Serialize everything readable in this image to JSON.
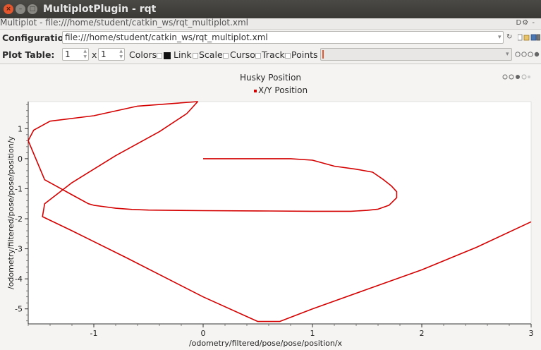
{
  "window": {
    "title": "MultiplotPlugin - rqt",
    "close_glyph": "×",
    "min_glyph": "–",
    "max_glyph": "□"
  },
  "dock": {
    "title": "Multiplot - file:///home/student/catkin_ws/rqt_multiplot.xml",
    "icons": "D⚙ -"
  },
  "config": {
    "label": "Configuration:",
    "value": "file:///home/student/catkin_ws/rqt_multiplot.xml"
  },
  "plot_table": {
    "label": "Plot Table:",
    "rows": "1",
    "x_label": "x",
    "cols": "1",
    "options": [
      {
        "label": "Colors",
        "checked": false
      },
      {
        "label": "Link",
        "checked": true
      },
      {
        "label": "Scale",
        "checked": false
      },
      {
        "label": "Cursor",
        "checked": false
      },
      {
        "label": "Track",
        "checked": false
      },
      {
        "label": "Points",
        "checked": false
      }
    ]
  },
  "plot": {
    "title": "Husky Position",
    "legend": "X/Y Position",
    "line_color": "#d40000"
  },
  "chart_data": {
    "type": "line",
    "title": "Husky Position",
    "xlabel": "/odometry/filtered/pose/pose/position/x",
    "ylabel": "/odometry/filtered/pose/pose/position/y",
    "xlim": [
      -1.6,
      3.0
    ],
    "ylim": [
      -5.5,
      1.9
    ],
    "xticks": [
      -1,
      0,
      1,
      2,
      3
    ],
    "yticks": [
      1,
      0,
      -1,
      -2,
      -3,
      -4,
      -5
    ],
    "grid": false,
    "legend_position": "top-center",
    "series": [
      {
        "name": "X/Y Position",
        "color": "#d40000",
        "x": [
          0.0,
          0.8,
          1.0,
          1.2,
          1.4,
          1.55,
          1.65,
          1.72,
          1.77,
          1.77,
          1.7,
          1.6,
          1.5,
          1.35,
          1.0,
          0.5,
          0.0,
          -0.3,
          -0.5,
          -0.65,
          -0.8,
          -0.9,
          -1.0,
          -1.05,
          -1.2,
          -1.35,
          -1.45,
          -1.6,
          -1.55,
          -1.4,
          -1.0,
          -0.6,
          -0.05,
          -0.15,
          -0.4,
          -0.8,
          -1.2,
          -1.45,
          -1.47,
          -1.2,
          -0.7,
          0.0,
          0.5,
          0.7,
          1.0,
          1.5,
          2.0,
          2.5,
          3.0
        ],
        "y": [
          0.0,
          0.0,
          -0.05,
          -0.25,
          -0.35,
          -0.45,
          -0.7,
          -0.9,
          -1.1,
          -1.3,
          -1.55,
          -1.68,
          -1.72,
          -1.75,
          -1.75,
          -1.74,
          -1.73,
          -1.72,
          -1.71,
          -1.69,
          -1.65,
          -1.6,
          -1.55,
          -1.5,
          -1.2,
          -0.9,
          -0.7,
          0.6,
          0.95,
          1.25,
          1.43,
          1.75,
          1.9,
          1.5,
          0.9,
          0.1,
          -0.8,
          -1.5,
          -1.93,
          -2.4,
          -3.3,
          -4.6,
          -5.42,
          -5.42,
          -5.0,
          -4.35,
          -3.7,
          -2.95,
          -2.1
        ]
      }
    ]
  }
}
